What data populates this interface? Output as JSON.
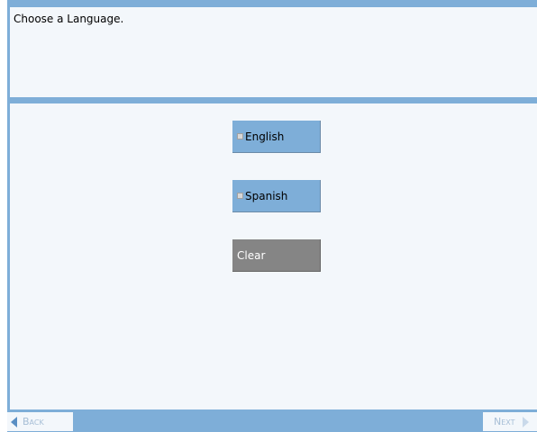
{
  "header": {
    "title": "Choose a Language."
  },
  "choices": [
    {
      "label": "English",
      "icon": "checkbox-icon"
    },
    {
      "label": "Spanish",
      "icon": "checkbox-icon"
    }
  ],
  "clear_button": {
    "label": "Clear"
  },
  "nav": {
    "back_label": "Back",
    "next_label": "Next"
  },
  "colors": {
    "accent_blue": "#7eaed8",
    "panel_background": "#f3f7fb",
    "clear_gray": "#858585",
    "disabled_text": "#a6bed6"
  }
}
